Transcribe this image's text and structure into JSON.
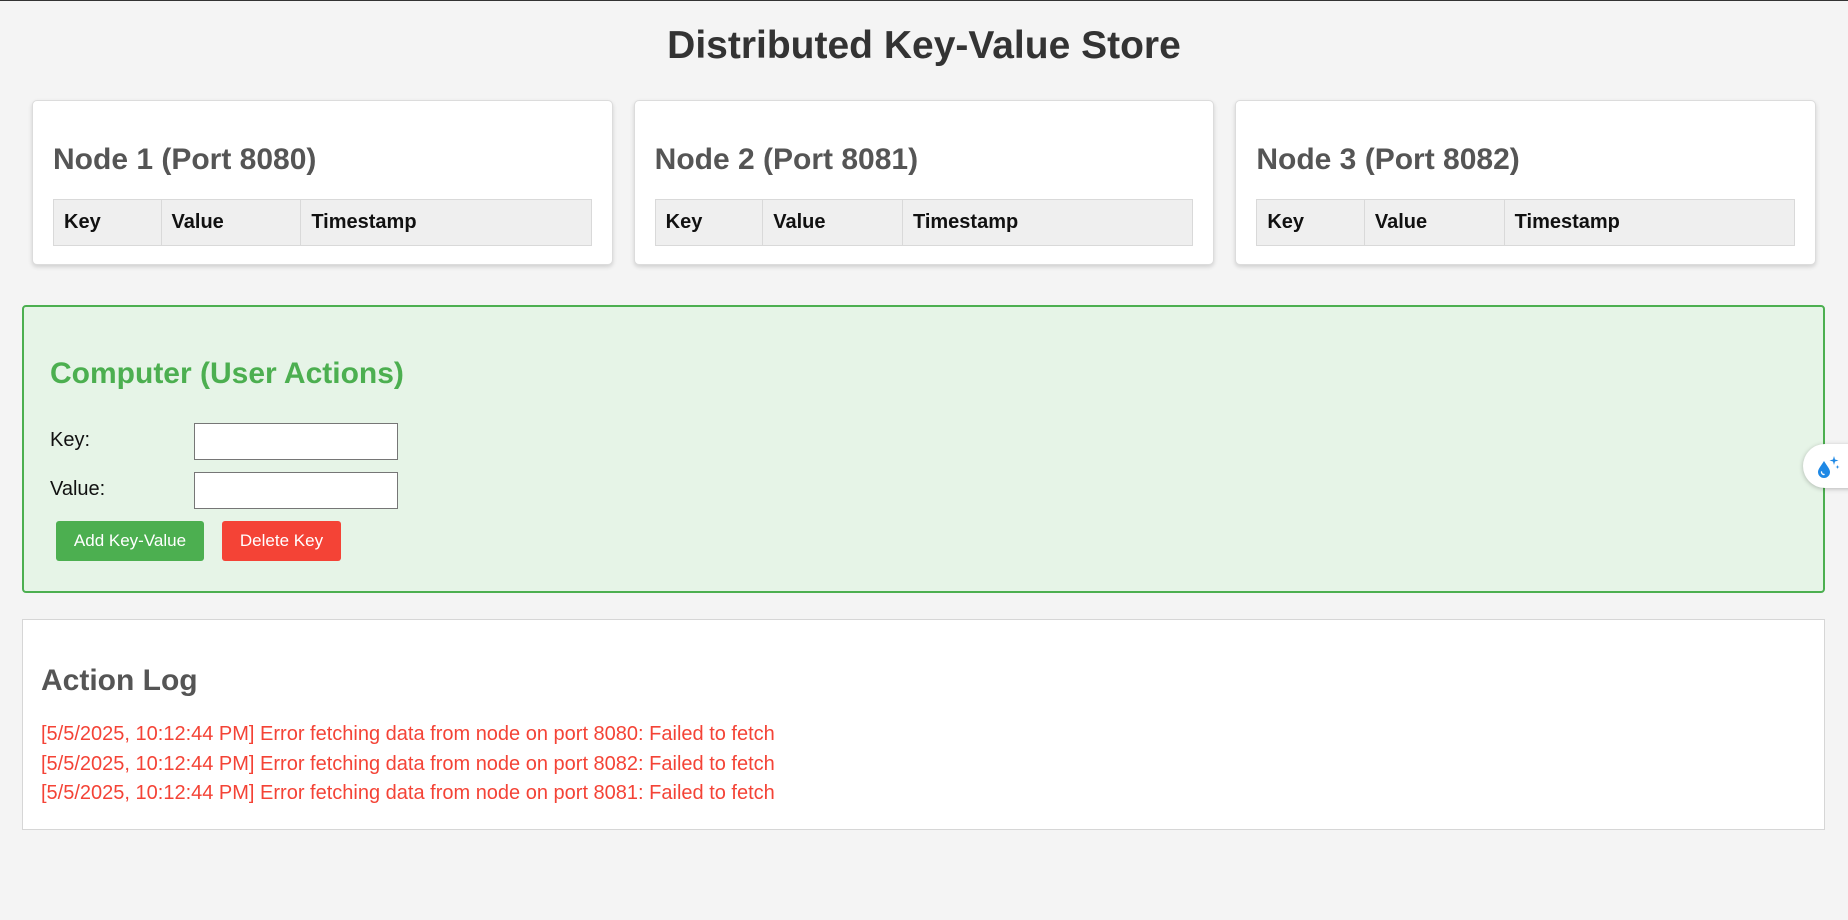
{
  "page": {
    "title": "Distributed Key-Value Store"
  },
  "nodes": [
    {
      "title": "Node 1 (Port 8080)",
      "columns": [
        "Key",
        "Value",
        "Timestamp"
      ],
      "rows": []
    },
    {
      "title": "Node 2 (Port 8081)",
      "columns": [
        "Key",
        "Value",
        "Timestamp"
      ],
      "rows": []
    },
    {
      "title": "Node 3 (Port 8082)",
      "columns": [
        "Key",
        "Value",
        "Timestamp"
      ],
      "rows": []
    }
  ],
  "computer": {
    "title": "Computer (User Actions)",
    "key_label": "Key:",
    "key_value": "",
    "value_label": "Value:",
    "value_value": "",
    "add_label": "Add Key-Value",
    "delete_label": "Delete Key"
  },
  "log": {
    "title": "Action Log",
    "entries": [
      "[5/5/2025, 10:12:44 PM] Error fetching data from node on port 8080: Failed to fetch",
      "[5/5/2025, 10:12:44 PM] Error fetching data from node on port 8082: Failed to fetch",
      "[5/5/2025, 10:12:44 PM] Error fetching data from node on port 8081: Failed to fetch"
    ]
  },
  "colors": {
    "success": "#4caf50",
    "danger": "#f44336",
    "panel_bg": "#e6f4e7",
    "page_bg": "#f4f4f4"
  },
  "icons": {
    "floating_widget": "water-drop-sparkle-icon"
  }
}
